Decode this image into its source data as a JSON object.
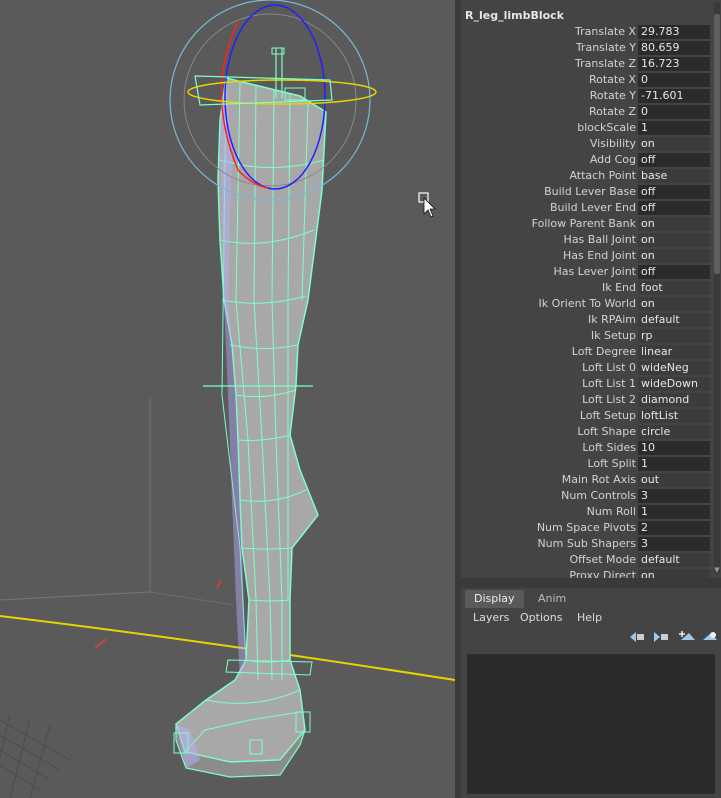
{
  "channel_box": {
    "node_name": "R_leg_limbBlock",
    "attributes": [
      {
        "label": "Translate X",
        "value": "29.783",
        "kind": "number"
      },
      {
        "label": "Translate Y",
        "value": "80.659",
        "kind": "number"
      },
      {
        "label": "Translate Z",
        "value": "16.723",
        "kind": "number"
      },
      {
        "label": "Rotate X",
        "value": "0",
        "kind": "number"
      },
      {
        "label": "Rotate Y",
        "value": "-71.601",
        "kind": "number"
      },
      {
        "label": "Rotate Z",
        "value": "0",
        "kind": "number"
      },
      {
        "label": "blockScale",
        "value": "1",
        "kind": "number"
      },
      {
        "label": "Visibility",
        "value": "on",
        "kind": "enum"
      },
      {
        "label": "Add Cog",
        "value": "off",
        "kind": "number"
      },
      {
        "label": "Attach Point",
        "value": "base",
        "kind": "enum"
      },
      {
        "label": "Build Lever Base",
        "value": "off",
        "kind": "number"
      },
      {
        "label": "Build Lever End",
        "value": "off",
        "kind": "number"
      },
      {
        "label": "Follow Parent Bank",
        "value": "on",
        "kind": "enum"
      },
      {
        "label": "Has Ball Joint",
        "value": "on",
        "kind": "enum"
      },
      {
        "label": "Has End Joint",
        "value": "on",
        "kind": "enum"
      },
      {
        "label": "Has Lever Joint",
        "value": "off",
        "kind": "number"
      },
      {
        "label": "Ik End",
        "value": "foot",
        "kind": "enum"
      },
      {
        "label": "Ik Orient To World",
        "value": "on",
        "kind": "enum"
      },
      {
        "label": "Ik RPAim",
        "value": "default",
        "kind": "enum"
      },
      {
        "label": "Ik Setup",
        "value": "rp",
        "kind": "enum"
      },
      {
        "label": "Loft Degree",
        "value": "linear",
        "kind": "enum"
      },
      {
        "label": "Loft List 0",
        "value": "wideNeg",
        "kind": "enum"
      },
      {
        "label": "Loft List 1",
        "value": "wideDown",
        "kind": "enum"
      },
      {
        "label": "Loft List 2",
        "value": "diamond",
        "kind": "enum"
      },
      {
        "label": "Loft Setup",
        "value": "loftList",
        "kind": "enum"
      },
      {
        "label": "Loft Shape",
        "value": "circle",
        "kind": "enum"
      },
      {
        "label": "Loft Sides",
        "value": "10",
        "kind": "number"
      },
      {
        "label": "Loft Split",
        "value": "1",
        "kind": "number"
      },
      {
        "label": "Main Rot Axis",
        "value": "out",
        "kind": "enum"
      },
      {
        "label": "Num Controls",
        "value": "3",
        "kind": "number"
      },
      {
        "label": "Num Roll",
        "value": "1",
        "kind": "number"
      },
      {
        "label": "Num Space Pivots",
        "value": "2",
        "kind": "number"
      },
      {
        "label": "Num Sub Shapers",
        "value": "3",
        "kind": "number"
      },
      {
        "label": "Offset Mode",
        "value": "default",
        "kind": "enum"
      },
      {
        "label": "Proxy Direct",
        "value": "on",
        "kind": "enum"
      }
    ]
  },
  "layer_editor": {
    "tabs": [
      {
        "label": "Display",
        "active": true
      },
      {
        "label": "Anim",
        "active": false
      }
    ],
    "menus": [
      "Layers",
      "Options",
      "Help"
    ],
    "toolbar_icons": [
      "move-layer-up-icon",
      "move-layer-down-icon",
      "new-layer-icon",
      "new-layer-selected-icon"
    ]
  },
  "colors": {
    "viewport_bg": "#5a5a5a",
    "wireframe": "#7dffc8",
    "horizon": "#e6d400",
    "rotate_x": "#ff2020",
    "rotate_y": "#2020ff",
    "rotate_outer": "#7ab8d8"
  }
}
